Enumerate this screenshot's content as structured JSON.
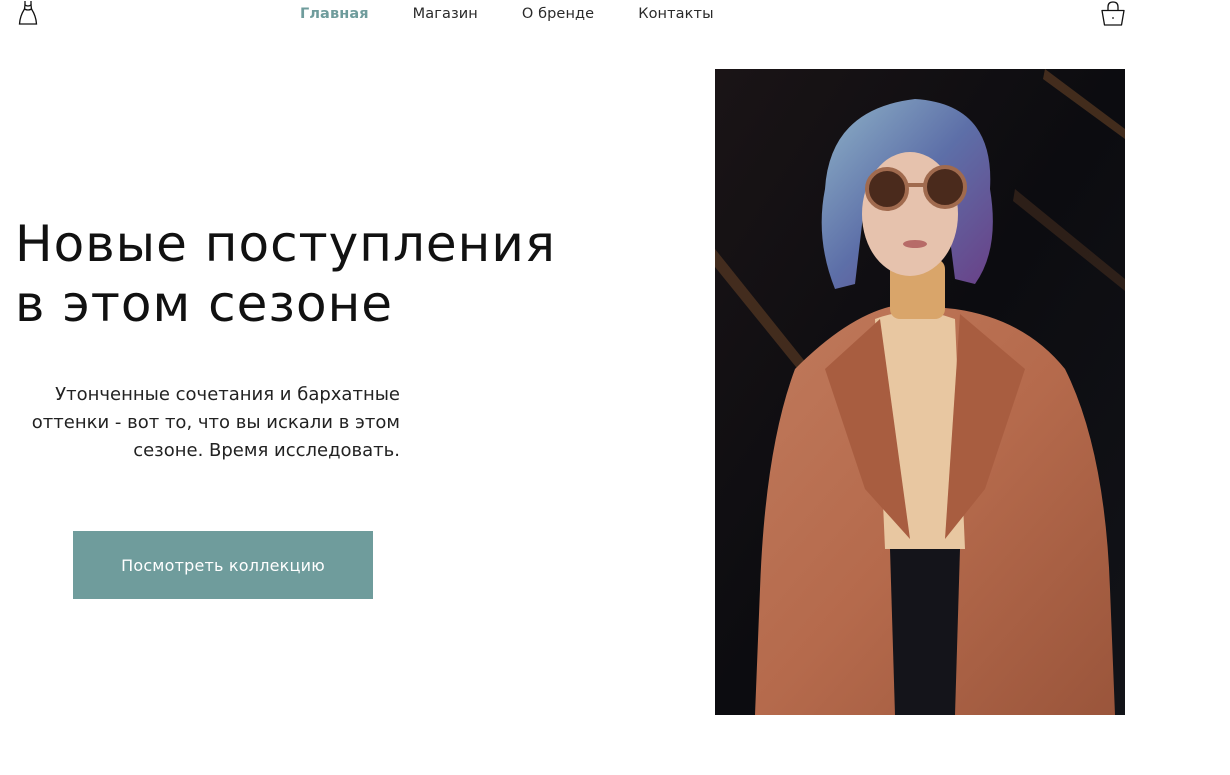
{
  "header": {
    "logo_icon": "dress-icon",
    "nav": [
      {
        "label": "Главная",
        "active": true
      },
      {
        "label": "Магазин",
        "active": false
      },
      {
        "label": "О бренде",
        "active": false
      },
      {
        "label": "Контакты",
        "active": false
      }
    ],
    "cart_icon": "shopping-basket-icon"
  },
  "hero": {
    "title_line1": "Новые поступления",
    "title_line2": "в этом сезоне",
    "subtitle_line1": "Утонченные сочетания и бархатные",
    "subtitle_line2": "оттенки - вот то, что вы искали в этом",
    "subtitle_line3": "сезоне. Время исследовать.",
    "cta_label": "Посмотреть коллекцию"
  },
  "colors": {
    "accent": "#6f9c9c",
    "text": "#1a1a1a",
    "background": "#ffffff"
  }
}
